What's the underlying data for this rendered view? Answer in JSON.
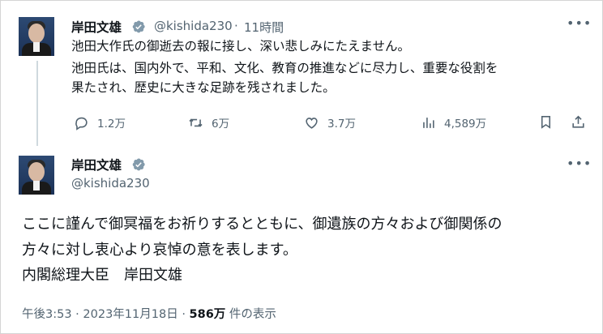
{
  "tweet1": {
    "name": "岸田文雄",
    "handle": "@kishida230",
    "separator": "·",
    "time": "11時間",
    "lines": [
      "池田大作氏の御逝去の報に接し、深い悲しみにたえません。",
      "池田氏は、国内外で、平和、文化、教育の推進などに尽力し、重要な役割を",
      "果たされ、歴史に大きな足跡を残されました。"
    ],
    "actions": {
      "reply_count": "1.2万",
      "retweet_count": "6万",
      "like_count": "3.7万",
      "view_count": "4,589万"
    },
    "icons": [
      "reply-icon",
      "retweet-icon",
      "like-icon",
      "views-icon",
      "bookmark-icon",
      "share-icon",
      "more-icon",
      "verified-icon"
    ]
  },
  "tweet2": {
    "name": "岸田文雄",
    "handle": "@kishida230",
    "lines": [
      "ここに謹んで御冥福をお祈りするとともに、御遺族の方々および御関係の",
      "方々に対し衷心より哀悼の意を表します。",
      "内閣総理大臣　岸田文雄"
    ],
    "meta": {
      "time": "午後3:53",
      "separator": "·",
      "date": "2023年11月18日",
      "separator2": "·",
      "views": "586万",
      "views_suffix": "件の表示"
    }
  },
  "colors": {
    "verified": "#829aab",
    "text": "#0f1419",
    "secondary": "#536471",
    "thread_line": "#cfd9de"
  }
}
